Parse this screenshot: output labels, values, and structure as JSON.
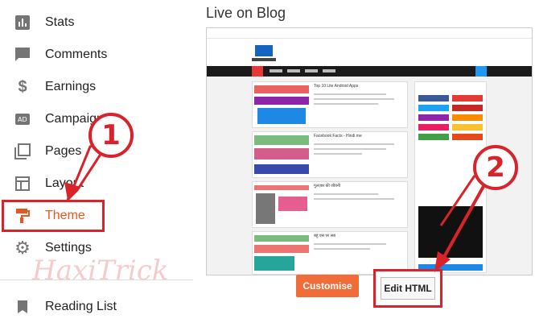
{
  "sidebar": {
    "items": [
      {
        "label": "Stats",
        "icon": "stats-icon"
      },
      {
        "label": "Comments",
        "icon": "comments-icon"
      },
      {
        "label": "Earnings",
        "icon": "dollar-icon"
      },
      {
        "label": "Campaigns",
        "icon": "ad-icon"
      },
      {
        "label": "Pages",
        "icon": "pages-icon"
      },
      {
        "label": "Layout",
        "icon": "layout-icon"
      },
      {
        "label": "Theme",
        "icon": "paint-roller-icon"
      },
      {
        "label": "Settings",
        "icon": "gear-icon"
      }
    ],
    "reading_list": {
      "label": "Reading List",
      "icon": "bookmark-icon"
    },
    "active_color": "#e8561f"
  },
  "watermark": "HaxiTrick",
  "main": {
    "title": "Live on Blog",
    "buttons": {
      "customise": "Customise",
      "edit_html": "Edit HTML"
    }
  },
  "preview": {
    "posts": [
      {
        "title": "Top 10 Lite Android Apps"
      },
      {
        "title": "Facebook Facts - Hindi me"
      },
      {
        "title": "गुलज़ार की जीवनी"
      },
      {
        "title": "बहु एस पर सब"
      }
    ]
  },
  "annotations": {
    "step1": "1",
    "step2": "2",
    "highlight_color": "#d9232a"
  }
}
